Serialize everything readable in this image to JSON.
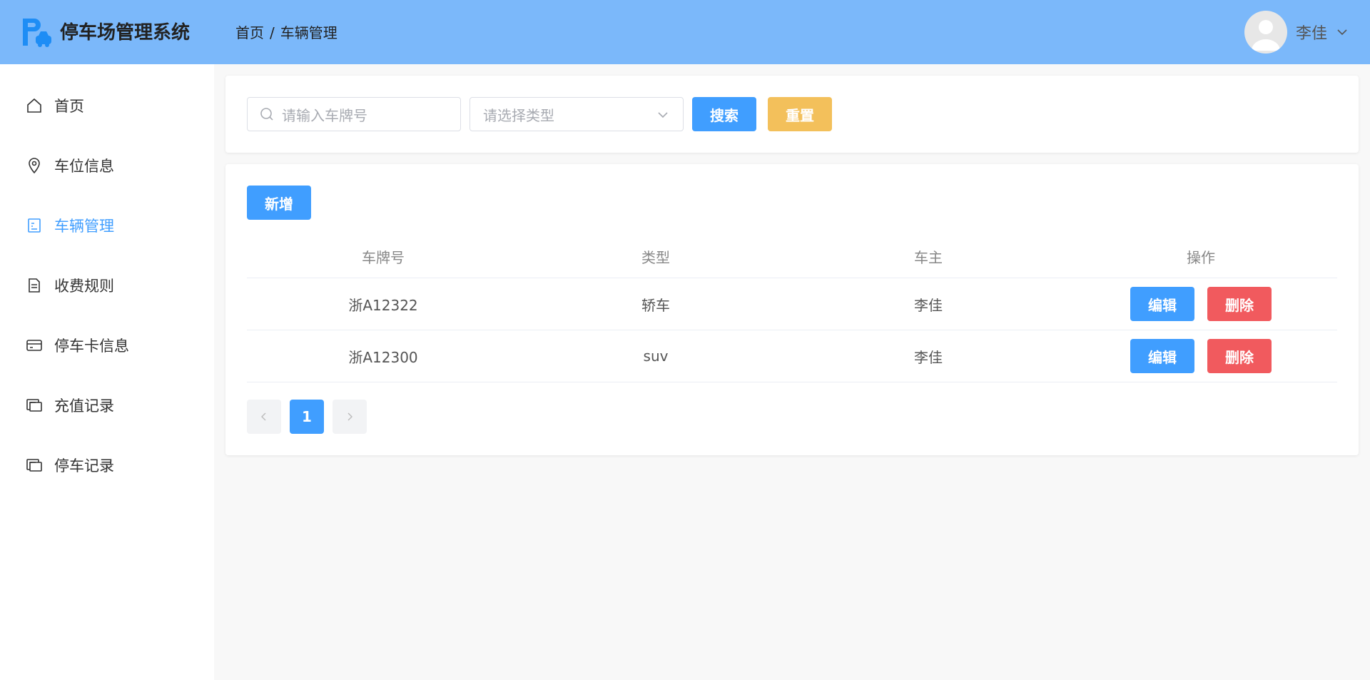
{
  "app": {
    "title": "停车场管理系统",
    "brand_color": "#409eff",
    "header_color": "#7bb8fa"
  },
  "breadcrumb": {
    "items": [
      "首页",
      "车辆管理"
    ],
    "separator": "/"
  },
  "user": {
    "name": "李佳",
    "avatar_icon": "user-avatar-icon",
    "dropdown_icon": "chevron-down-icon"
  },
  "sidebar": {
    "items": [
      {
        "label": "首页",
        "icon": "home-icon",
        "active": false
      },
      {
        "label": "车位信息",
        "icon": "location-pin-icon",
        "active": false
      },
      {
        "label": "车辆管理",
        "icon": "document-icon",
        "active": true
      },
      {
        "label": "收费规则",
        "icon": "document-list-icon",
        "active": false
      },
      {
        "label": "停车卡信息",
        "icon": "credit-card-icon",
        "active": false
      },
      {
        "label": "充值记录",
        "icon": "wallet-icon",
        "active": false
      },
      {
        "label": "停车记录",
        "icon": "wallet-icon",
        "active": false
      }
    ]
  },
  "search": {
    "plate_placeholder": "请输入车牌号",
    "type_placeholder": "请选择类型",
    "search_label": "搜索",
    "reset_label": "重置"
  },
  "table": {
    "add_label": "新增",
    "columns": [
      "车牌号",
      "类型",
      "车主",
      "操作"
    ],
    "rows": [
      {
        "plate": "浙A12322",
        "type": "轿车",
        "owner": "李佳"
      },
      {
        "plate": "浙A12300",
        "type": "suv",
        "owner": "李佳"
      }
    ],
    "edit_label": "编辑",
    "delete_label": "删除"
  },
  "pagination": {
    "current_page": "1",
    "prev_icon": "chevron-left-icon",
    "next_icon": "chevron-right-icon"
  }
}
